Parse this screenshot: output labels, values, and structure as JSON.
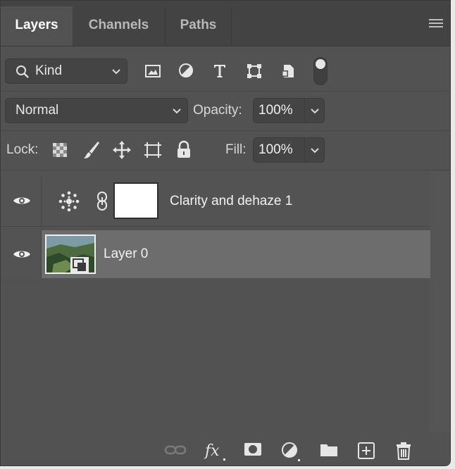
{
  "tabs": [
    {
      "label": "Layers",
      "active": true
    },
    {
      "label": "Channels",
      "active": false
    },
    {
      "label": "Paths",
      "active": false
    }
  ],
  "filter": {
    "kind_label": "Kind",
    "icons": [
      "pixel-layer-filter-icon",
      "adjustment-layer-filter-icon",
      "type-layer-filter-icon",
      "shape-layer-filter-icon",
      "smart-object-filter-icon"
    ]
  },
  "blend": {
    "mode": "Normal",
    "opacity_label": "Opacity:",
    "opacity_value": "100%"
  },
  "lock": {
    "label": "Lock:",
    "fill_label": "Fill:",
    "fill_value": "100%"
  },
  "layers": [
    {
      "name": "Clarity and dehaze 1",
      "visible": true,
      "type": "adjustment",
      "selected": false
    },
    {
      "name": "Layer 0",
      "visible": true,
      "type": "smart-object",
      "selected": true
    }
  ],
  "footer_icons": [
    "link-layers-icon",
    "fx-icon",
    "add-mask-icon",
    "new-adjustment-icon",
    "new-group-icon",
    "new-layer-icon",
    "delete-layer-icon"
  ],
  "colors": {
    "panel_bg": "#525252",
    "selected_row": "#6d6d6d",
    "text": "#f2f2f2"
  }
}
